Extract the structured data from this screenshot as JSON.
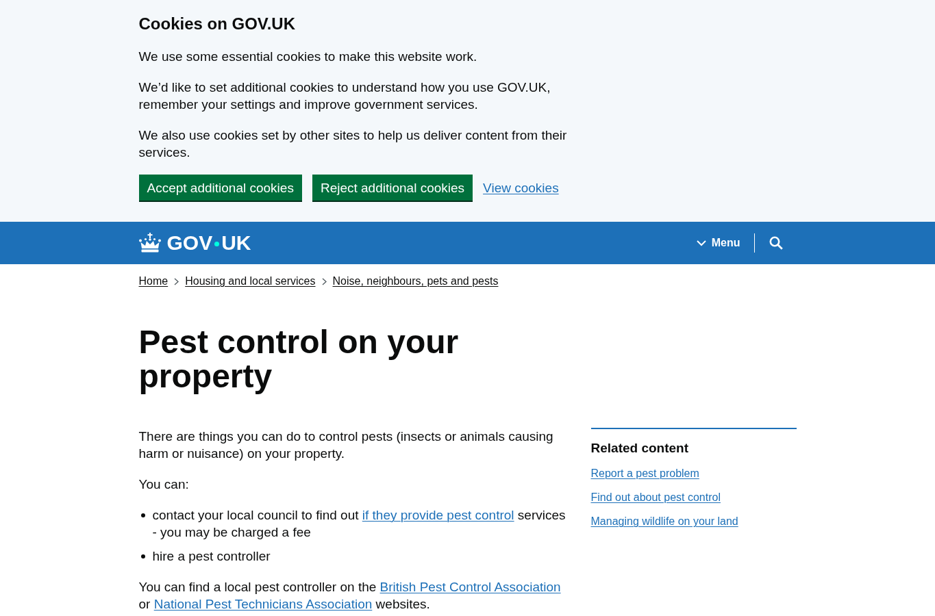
{
  "cookie_banner": {
    "title": "Cookies on GOV.UK",
    "paragraphs": [
      "We use some essential cookies to make this website work.",
      "We’d like to set additional cookies to understand how you use GOV.UK, remember your settings and improve government services.",
      "We also use cookies set by other sites to help us deliver content from their services."
    ],
    "buttons": [
      "Accept additional cookies",
      "Reject additional cookies"
    ],
    "link": "View cookies"
  },
  "header": {
    "logo": [
      "GOV",
      "UK"
    ],
    "menu": "Menu"
  },
  "breadcrumbs": [
    "Home",
    "Housing and local services",
    "Noise, neighbours, pets and pests"
  ],
  "title": "Pest control on your property",
  "body": [
    {
      "kind": "paragraph",
      "segments": [
        {
          "kind": "text",
          "text": "There are things you can do to control pests (insects or animals causing harm or nuisance) on your property."
        }
      ]
    },
    {
      "kind": "paragraph",
      "segments": [
        {
          "kind": "text",
          "text": "You can:"
        }
      ]
    },
    {
      "kind": "list",
      "items": [
        {
          "segments": [
            {
              "kind": "text",
              "text": "contact your local council to find out "
            },
            {
              "kind": "link",
              "text": "if they provide pest control"
            },
            {
              "kind": "text",
              "text": " services - you may be charged a fee"
            }
          ]
        },
        {
          "segments": [
            {
              "kind": "text",
              "text": "hire a pest controller"
            }
          ]
        }
      ]
    },
    {
      "kind": "paragraph",
      "segments": [
        {
          "kind": "text",
          "text": "You can find a local pest controller on the "
        },
        {
          "kind": "link",
          "text": "British Pest Control Association"
        },
        {
          "kind": "text",
          "text": " or "
        },
        {
          "kind": "link",
          "text": "National Pest Technicians Association"
        },
        {
          "kind": "text",
          "text": " websites."
        }
      ]
    }
  ],
  "related": {
    "title": "Related content",
    "links": [
      "Report a pest problem",
      "Find out about pest control",
      "Managing wildlife on your land"
    ]
  }
}
